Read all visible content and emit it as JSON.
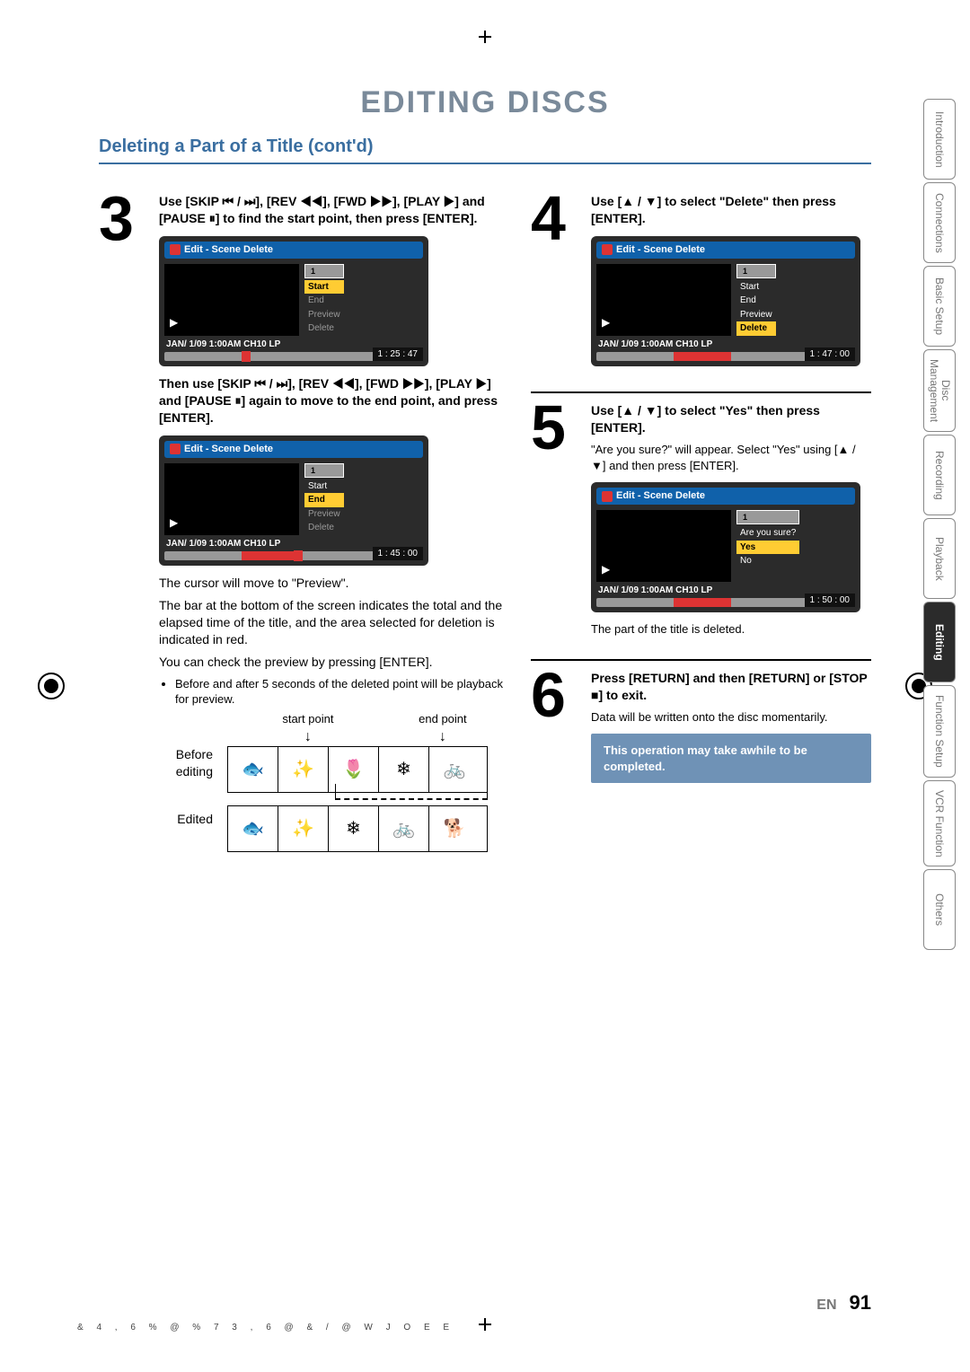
{
  "page": {
    "title": "EDITING DISCS",
    "subtitle": "Deleting a Part of a Title (cont'd)",
    "lang": "EN",
    "number": "91",
    "footer_code": "& 4 , 6 % @ % 7 3    , 6 @ & / @ W    J O E E"
  },
  "steps": {
    "s3": {
      "num": "3",
      "lead": "Use [SKIP ⏮ / ⏭], [REV ◀◀], [FWD ▶▶], [PLAY ▶] and [PAUSE ⏸] to find the start point, then press [ENTER].",
      "lead2": "Then use [SKIP ⏮ / ⏭], [REV ◀◀], [FWD ▶▶], [PLAY ▶] and [PAUSE ⏸] again to move to the end point, and press [ENTER].",
      "body1": "The cursor will move to \"Preview\".",
      "body2": "The bar at the bottom of the screen indicates the total and the elapsed time of the title, and the area selected for deletion is indicated in red.",
      "body3": "You can check the preview by pressing [ENTER].",
      "bullet1": "Before and after 5 seconds of the deleted point will be playback for preview.",
      "start_point": "start point",
      "end_point": "end point",
      "before": "Before editing",
      "edited": "Edited"
    },
    "s4": {
      "num": "4",
      "lead": "Use [▲ / ▼] to select \"Delete\" then press [ENTER]."
    },
    "s5": {
      "num": "5",
      "lead": "Use [▲ / ▼] to select \"Yes\" then press [ENTER].",
      "body1": "\"Are you sure?\" will appear. Select \"Yes\" using [▲ / ▼] and then press [ENTER].",
      "body2": "The part of the title is deleted."
    },
    "s6": {
      "num": "6",
      "lead": "Press [RETURN] and then [RETURN] or [STOP ■] to exit.",
      "body1": "Data will be written onto the disc momentarily.",
      "note": "This operation may take awhile to be completed."
    }
  },
  "scene": {
    "title": "Edit - Scene Delete",
    "thumb_num": "1",
    "item_start": "Start",
    "item_end": "End",
    "item_preview": "Preview",
    "item_delete": "Delete",
    "item_sure": "Are you sure?",
    "item_yes": "Yes",
    "item_no": "No",
    "footer": "JAN/ 1/09 1:00AM CH10   LP",
    "time_a": "1 : 25 : 47",
    "time_b": "1 : 45 : 00",
    "time_c": "1 : 47 : 00",
    "time_d": "1 : 50 : 00"
  },
  "tabs": {
    "t1": "Introduction",
    "t2": "Connections",
    "t3": "Basic Setup",
    "t4a": "Disc",
    "t4b": "Management",
    "t5": "Recording",
    "t6": "Playback",
    "t7": "Editing",
    "t8": "Function Setup",
    "t9": "VCR Function",
    "t10": "Others"
  }
}
